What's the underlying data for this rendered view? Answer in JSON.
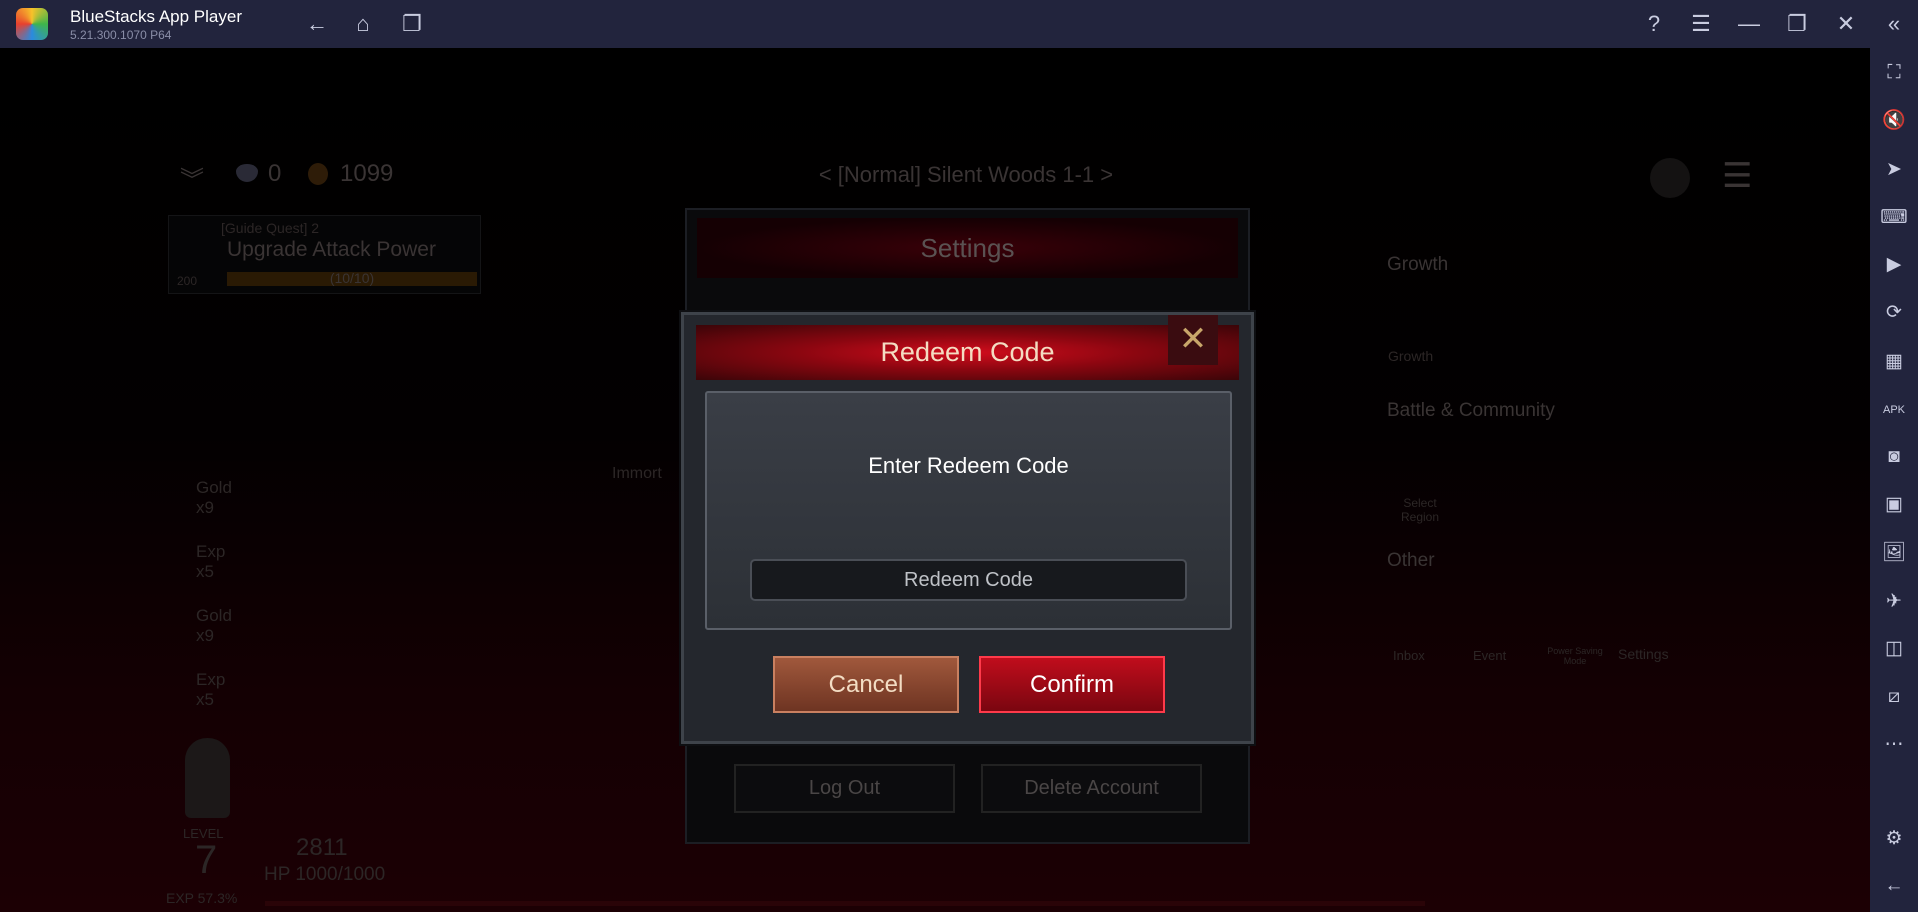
{
  "titlebar": {
    "app_name": "BlueStacks App Player",
    "version": "5.21.300.1070  P64",
    "nav": [
      {
        "icon": "back-arrow-icon",
        "glyph": "←"
      },
      {
        "icon": "home-icon",
        "glyph": "⌂"
      },
      {
        "icon": "recent-apps-icon",
        "glyph": "❐"
      }
    ],
    "controls": [
      {
        "icon": "help-icon",
        "glyph": "?"
      },
      {
        "icon": "menu-icon",
        "glyph": "☰"
      },
      {
        "icon": "minimize-icon",
        "glyph": "—"
      },
      {
        "icon": "restore-icon",
        "glyph": "❐"
      },
      {
        "icon": "close-icon",
        "glyph": "✕"
      },
      {
        "icon": "collapse-sidebar-icon",
        "glyph": "«"
      }
    ]
  },
  "sidebar": {
    "items": [
      {
        "icon": "fullscreen-icon",
        "glyph": "⛶"
      },
      {
        "icon": "volume-mute-icon",
        "glyph": "🔇"
      },
      {
        "icon": "pointer-icon",
        "glyph": "➤"
      },
      {
        "icon": "keyboard-icon",
        "glyph": "⌨"
      },
      {
        "icon": "macro-play-icon",
        "glyph": "▶"
      },
      {
        "icon": "rotate-sync-icon",
        "glyph": "⟳"
      },
      {
        "icon": "performance-icon",
        "glyph": "▦"
      },
      {
        "icon": "install-apk-icon",
        "glyph": "APK"
      },
      {
        "icon": "screenshot-icon",
        "glyph": "◙"
      },
      {
        "icon": "record-icon",
        "glyph": "▣"
      },
      {
        "icon": "media-folder-icon",
        "glyph": "🖼"
      },
      {
        "icon": "airplane-icon",
        "glyph": "✈"
      },
      {
        "icon": "multi-instance-icon",
        "glyph": "◫"
      },
      {
        "icon": "eco-mode-icon",
        "glyph": "⧄"
      },
      {
        "icon": "more-icon",
        "glyph": "⋯"
      }
    ],
    "bottom": [
      {
        "icon": "settings-icon",
        "glyph": "⚙"
      },
      {
        "icon": "back-icon",
        "glyph": "←"
      }
    ]
  },
  "game": {
    "hud": {
      "gems": "0",
      "gold": "1099",
      "stage": "< [Normal] Silent Woods 1-1 >"
    },
    "quest": {
      "label": "[Guide Quest] 2",
      "title": "Upgrade Attack Power",
      "progress": "(10/10)",
      "progress_value": 1.0,
      "reward": "200"
    },
    "rewards": [
      {
        "name": "Gold",
        "qty": "x9"
      },
      {
        "name": "Exp",
        "qty": "x5"
      },
      {
        "name": "Gold",
        "qty": "x9"
      },
      {
        "name": "Exp",
        "qty": "x5"
      }
    ],
    "player": {
      "level_label": "LEVEL",
      "level": "7",
      "power": "2811",
      "hp": "HP 1000/1000",
      "exp": "EXP 57.3%"
    },
    "side_text": "Immort",
    "menu": {
      "growth_header": "Growth",
      "growth_item": "Growth",
      "battle_header": "Battle & Community",
      "battle_item": "Select Region",
      "other_header": "Other",
      "other_items": [
        "Inbox",
        "Event",
        "Power Saving Mode",
        "Settings"
      ]
    },
    "settings": {
      "title": "Settings",
      "logout": "Log Out",
      "delete": "Delete Account"
    }
  },
  "dialog": {
    "title": "Redeem Code",
    "prompt": "Enter Redeem Code",
    "input_placeholder": "Redeem Code",
    "input_value": "",
    "cancel": "Cancel",
    "confirm": "Confirm"
  },
  "colors": {
    "titlebar": "#22243d",
    "confirm": "#c00d1c",
    "cancel": "#a0583c",
    "header_red": "#d10c1c"
  }
}
